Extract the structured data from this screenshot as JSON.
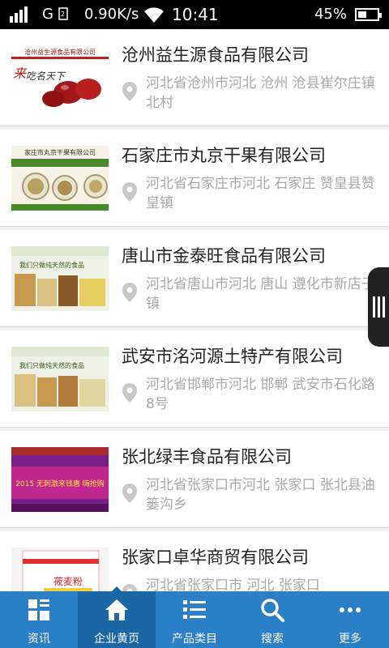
{
  "status_bar": {
    "carrier_letter": "G",
    "net_speed": "0.90K/s",
    "time": "10:41",
    "battery_percent": "45%",
    "battery_level": 0.45
  },
  "listings": [
    {
      "name": "沧州益生源食品有限公司",
      "address": "河北省沧州市河北 沧州 沧县崔尔庄镇北村",
      "thumb_caption": "沧州益生源食品有限公司"
    },
    {
      "name": "石家庄市丸京干果有限公司",
      "address": "河北省石家庄市河北 石家庄 赞皇县赞皇镇",
      "thumb_caption": "家庄市丸京干果有限公司"
    },
    {
      "name": "唐山市金泰旺食品有限公司",
      "address": "河北省唐山市河北 唐山 遵化市新店子镇",
      "thumb_caption": "我们只做纯天然的食品"
    },
    {
      "name": "武安市洺河源土特产有限公司",
      "address": "河北省邯郸市河北 邯郸 武安市石化路8号",
      "thumb_caption": "我们只做纯天然的食品"
    },
    {
      "name": "张北绿丰食品有限公司",
      "address": "河北省张家口市河北 张家口 张北县油篓沟乡",
      "thumb_caption": "2015 无刺激来钱惠 嗨抢购"
    },
    {
      "name": "张家口卓华商贸有限公司",
      "address": "河北省张家口市 河北 张家口",
      "thumb_caption": "莜麦粉"
    }
  ],
  "tabs": [
    {
      "label": "资讯",
      "icon": "grid-icon"
    },
    {
      "label": "企业黄页",
      "icon": "home-icon"
    },
    {
      "label": "产品类目",
      "icon": "list-icon"
    },
    {
      "label": "搜索",
      "icon": "search-icon"
    },
    {
      "label": "更多",
      "icon": "more-icon"
    }
  ],
  "active_tab": 1,
  "colors": {
    "tab_bar": "#2a7fc6",
    "tab_active": "#1b67a6",
    "title_text": "#222222",
    "address_text": "#a8a8a8"
  }
}
